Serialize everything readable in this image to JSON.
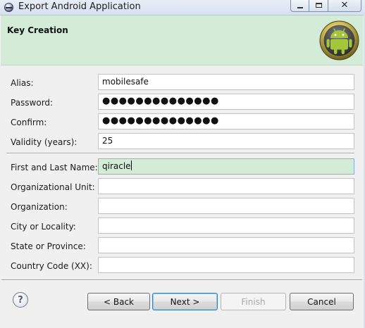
{
  "window": {
    "title": "Export Android Application"
  },
  "banner": {
    "title": "Key Creation"
  },
  "form": {
    "alias": {
      "label": "Alias:",
      "value": "mobilesafe"
    },
    "password": {
      "label": "Password:",
      "value": "●●●●●●●●●●●●●●"
    },
    "confirm": {
      "label": "Confirm:",
      "value": "●●●●●●●●●●●●●●"
    },
    "validity": {
      "label": "Validity (years):",
      "value": "25"
    },
    "name": {
      "label": "First and Last Name:",
      "value": "qiracle"
    },
    "org_unit": {
      "label": "Organizational Unit:",
      "value": ""
    },
    "organization": {
      "label": "Organization:",
      "value": ""
    },
    "city": {
      "label": "City or Locality:",
      "value": ""
    },
    "state": {
      "label": "State or Province:",
      "value": ""
    },
    "country": {
      "label": "Country Code (XX):",
      "value": ""
    }
  },
  "buttons": {
    "help": "?",
    "back": "< Back",
    "next": "Next >",
    "finish": "Finish",
    "cancel": "Cancel"
  },
  "icons": {
    "window_icon": "eclipse-icon",
    "banner_icon": "android-logo-icon"
  },
  "colors": {
    "banner_bg": "#d3ecd7",
    "focused_field_bg": "#d3ecd7",
    "android_green": "#a4c639"
  }
}
